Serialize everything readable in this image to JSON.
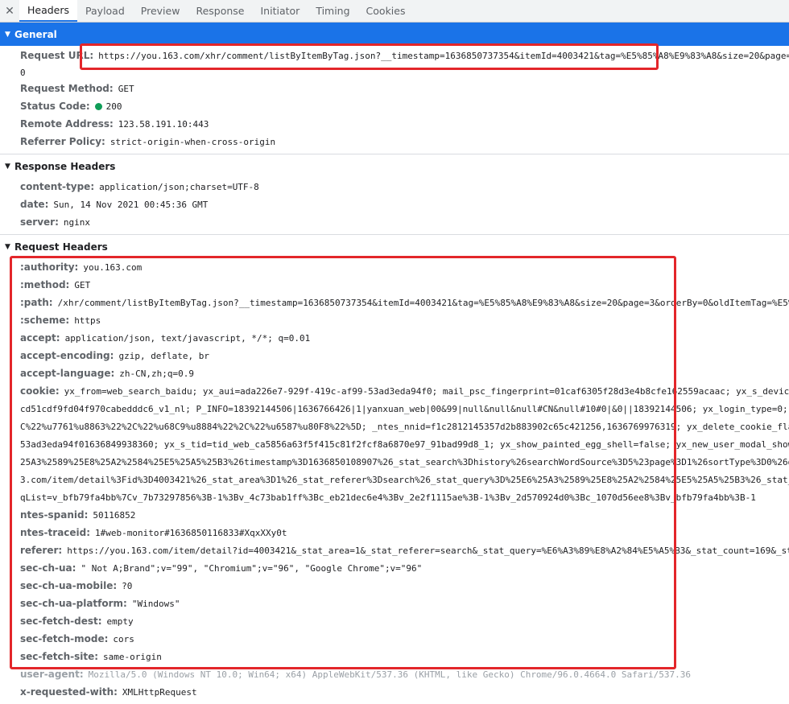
{
  "tabs": {
    "close_glyph": "✕",
    "items": [
      "Headers",
      "Payload",
      "Preview",
      "Response",
      "Initiator",
      "Timing",
      "Cookies"
    ],
    "active": "Headers"
  },
  "general": {
    "title": "General",
    "request_url_key": "Request URL:",
    "request_url": "https://you.163.com/xhr/comment/listByItemByTag.json?__timestamp=1636850737354&itemId=4003421&tag=%E5%85%A8%E9%83%A8&size=20&page=3&o",
    "request_url_cont": "0",
    "request_method_key": "Request Method:",
    "request_method": "GET",
    "status_code_key": "Status Code:",
    "status_code": "200",
    "remote_address_key": "Remote Address:",
    "remote_address": "123.58.191.10:443",
    "referrer_policy_key": "Referrer Policy:",
    "referrer_policy": "strict-origin-when-cross-origin"
  },
  "response_headers": {
    "title": "Response Headers",
    "items": [
      {
        "key": "content-type:",
        "value": "application/json;charset=UTF-8"
      },
      {
        "key": "date:",
        "value": "Sun, 14 Nov 2021 00:45:36 GMT"
      },
      {
        "key": "server:",
        "value": "nginx"
      }
    ]
  },
  "request_headers": {
    "title": "Request Headers",
    "authority": {
      "key": ":authority:",
      "value": "you.163.com"
    },
    "method": {
      "key": ":method:",
      "value": "GET"
    },
    "path": {
      "key": ":path:",
      "value": "/xhr/comment/listByItemByTag.json?__timestamp=1636850737354&itemId=4003421&tag=%E5%85%A8%E9%83%A8&size=20&page=3&orderBy=0&oldItemTag=%E5%85%A8"
    },
    "scheme": {
      "key": ":scheme:",
      "value": "https"
    },
    "accept": {
      "key": "accept:",
      "value": "application/json, text/javascript, */*; q=0.01"
    },
    "accept_encoding": {
      "key": "accept-encoding:",
      "value": "gzip, deflate, br"
    },
    "accept_language": {
      "key": "accept-language:",
      "value": "zh-CN,zh;q=0.9"
    },
    "cookie": {
      "key": "cookie:",
      "line1": "yx_from=web_search_baidu; yx_aui=ada226e7-929f-419c-af99-53ad3eda94f0; mail_psc_fingerprint=01caf6305f28d3e4b8cfe162559acaac; yx_s_device=",
      "line2": "cd51cdf9fd04f970cabedddc6_v1_nl; P_INFO=18392144506|1636766426|1|yanxuan_web|00&99|null&null&null#CN&null#10#0|&0||18392144506; yx_login_type=0; yx",
      "line3": "C%22%u7761%u8863%22%2C%22%u68C9%u8884%22%2C%22%u6587%u80F8%22%5D; _ntes_nnid=f1c2812145357d2b883902c65c421256,1636769976319; yx_delete_cookie_fla",
      "line4": "53ad3eda94f01636849938360; yx_s_tid=tid_web_ca5856a63f5f415c81f2fcf8a6870e97_91bad99d8_1; yx_show_painted_egg_shell=false; yx_new_user_modal_show",
      "line5": "25A3%2589%25E8%25A2%2584%25E5%25A5%25B3%26timestamp%3D1636850108907%26_stat_search%3Dhistory%26searchWordSource%3D5%23page%3D1%26sortType%3D0%26d",
      "line6": "3.com/item/detail%3Fid%3D4003421%26_stat_area%3D1%26_stat_referer%3Dsearch%26_stat_query%3D%25E6%25A3%2589%25E8%25A2%2584%25E5%25A5%25B3%26_stat_",
      "line7": "qList=v_bfb79fa4bb%7Cv_7b73297856%3B-1%3Bv_4c73bab1ff%3Bc_eb21dec6e4%3Bv_2e2f1115ae%3B-1%3Bv_2d570924d0%3Bc_1070d56ee8%3Bv_bfb79fa4bb%3B-1"
    },
    "ntes_spanid": {
      "key": "ntes-spanid:",
      "value": "50116852"
    },
    "ntes_traceid": {
      "key": "ntes-traceid:",
      "value": "1#web-monitor#1636850116833#XqxXXy0t"
    },
    "referer": {
      "key": "referer:",
      "value": "https://you.163.com/item/detail?id=4003421&_stat_area=1&_stat_referer=search&_stat_query=%E6%A3%89%E8%A2%84%E5%A5%B3&_stat_count=169&_sta"
    },
    "sec_ch_ua": {
      "key": "sec-ch-ua:",
      "value": "\" Not A;Brand\";v=\"99\", \"Chromium\";v=\"96\", \"Google Chrome\";v=\"96\""
    },
    "sec_ch_ua_mobile": {
      "key": "sec-ch-ua-mobile:",
      "value": "?0"
    },
    "sec_ch_ua_platform": {
      "key": "sec-ch-ua-platform:",
      "value": "\"Windows\""
    },
    "sec_fetch_dest": {
      "key": "sec-fetch-dest:",
      "value": "empty"
    },
    "sec_fetch_mode": {
      "key": "sec-fetch-mode:",
      "value": "cors"
    },
    "sec_fetch_site": {
      "key": "sec-fetch-site:",
      "value": "same-origin"
    },
    "user_agent": {
      "key": "user-agent:",
      "value": "Mozilla/5.0 (Windows NT 10.0; Win64; x64) AppleWebKit/537.36 (KHTML, like Gecko) Chrome/96.0.4664.0 Safari/537.36"
    },
    "x_requested_with": {
      "key": "x-requested-with:",
      "value": "XMLHttpRequest"
    }
  },
  "colors": {
    "accent": "#1a73e8",
    "highlight_box": "#e3262a",
    "status_ok": "#0f9d58"
  }
}
